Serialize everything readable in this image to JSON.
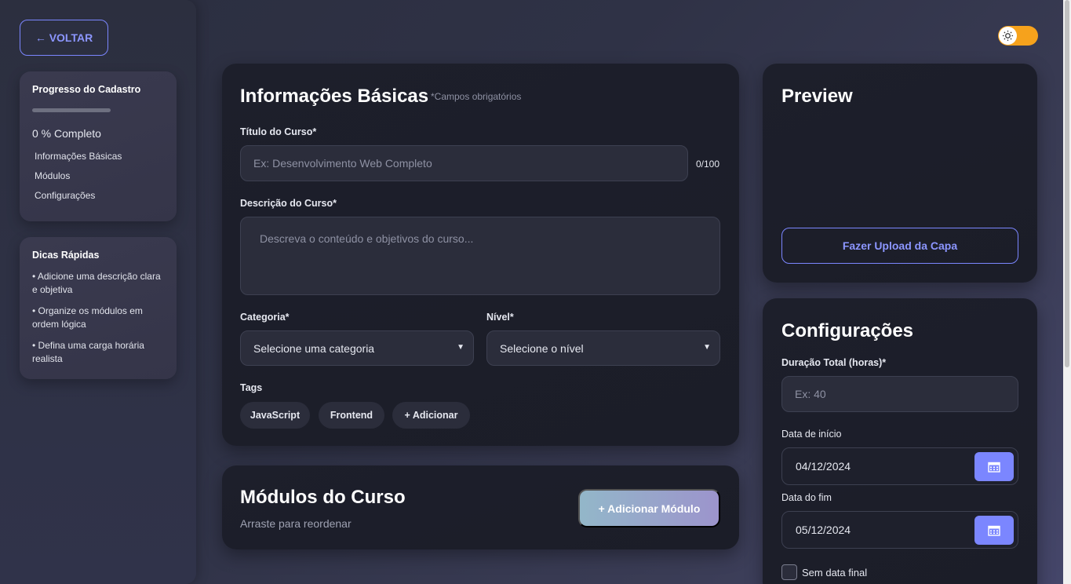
{
  "sidebar": {
    "back_label": "← VOLTAR",
    "progress": {
      "title": "Progresso do Cadastro",
      "percent": 0,
      "text": "0 % Completo",
      "steps": [
        "Informações Básicas",
        "Módulos",
        "Configurações"
      ]
    },
    "tips": {
      "title": "Dicas Rápidas",
      "items": [
        "• Adicione uma descrição clara e objetiva",
        "• Organize os módulos em ordem lógica",
        "• Defina uma carga horária realista"
      ]
    }
  },
  "theme_toggle": {
    "icon": "sun-icon",
    "on": true,
    "color": "#f6a21c"
  },
  "basic_info": {
    "title": "Informações Básicas",
    "required_note": "*Campos obrigatórios",
    "course_title": {
      "label": "Título do Curso*",
      "placeholder": "Ex: Desenvolvimento Web Completo",
      "value": "",
      "counter": "0/100"
    },
    "description": {
      "label": "Descrição do Curso*",
      "placeholder": "Descreva o conteúdo e objetivos do curso..."
    },
    "category": {
      "label": "Categoria*",
      "selected": "Selecione uma categoria"
    },
    "level": {
      "label": "Nível*",
      "selected": "Selecione o nível"
    },
    "tags": {
      "label": "Tags",
      "items": [
        "JavaScript",
        "Frontend"
      ],
      "add_label": "+ Adicionar"
    }
  },
  "modules": {
    "title": "Módulos do Curso",
    "subtitle": "Arraste para reordenar",
    "add_label": "+ Adicionar Módulo"
  },
  "preview": {
    "title": "Preview",
    "upload_label": "Fazer Upload da Capa"
  },
  "config": {
    "title": "Configurações",
    "duration": {
      "label": "Duração Total (horas)*",
      "placeholder": "Ex: 40"
    },
    "start_date": {
      "label": "Data de início",
      "value": "04/12/2024"
    },
    "end_date": {
      "label": "Data do fim",
      "value": "05/12/2024"
    },
    "no_end": {
      "label": "Sem data final",
      "checked": false
    }
  },
  "colors": {
    "accent": "#7b86ff",
    "toggle": "#f6a21c",
    "card_bg": "#1d1f2b"
  }
}
